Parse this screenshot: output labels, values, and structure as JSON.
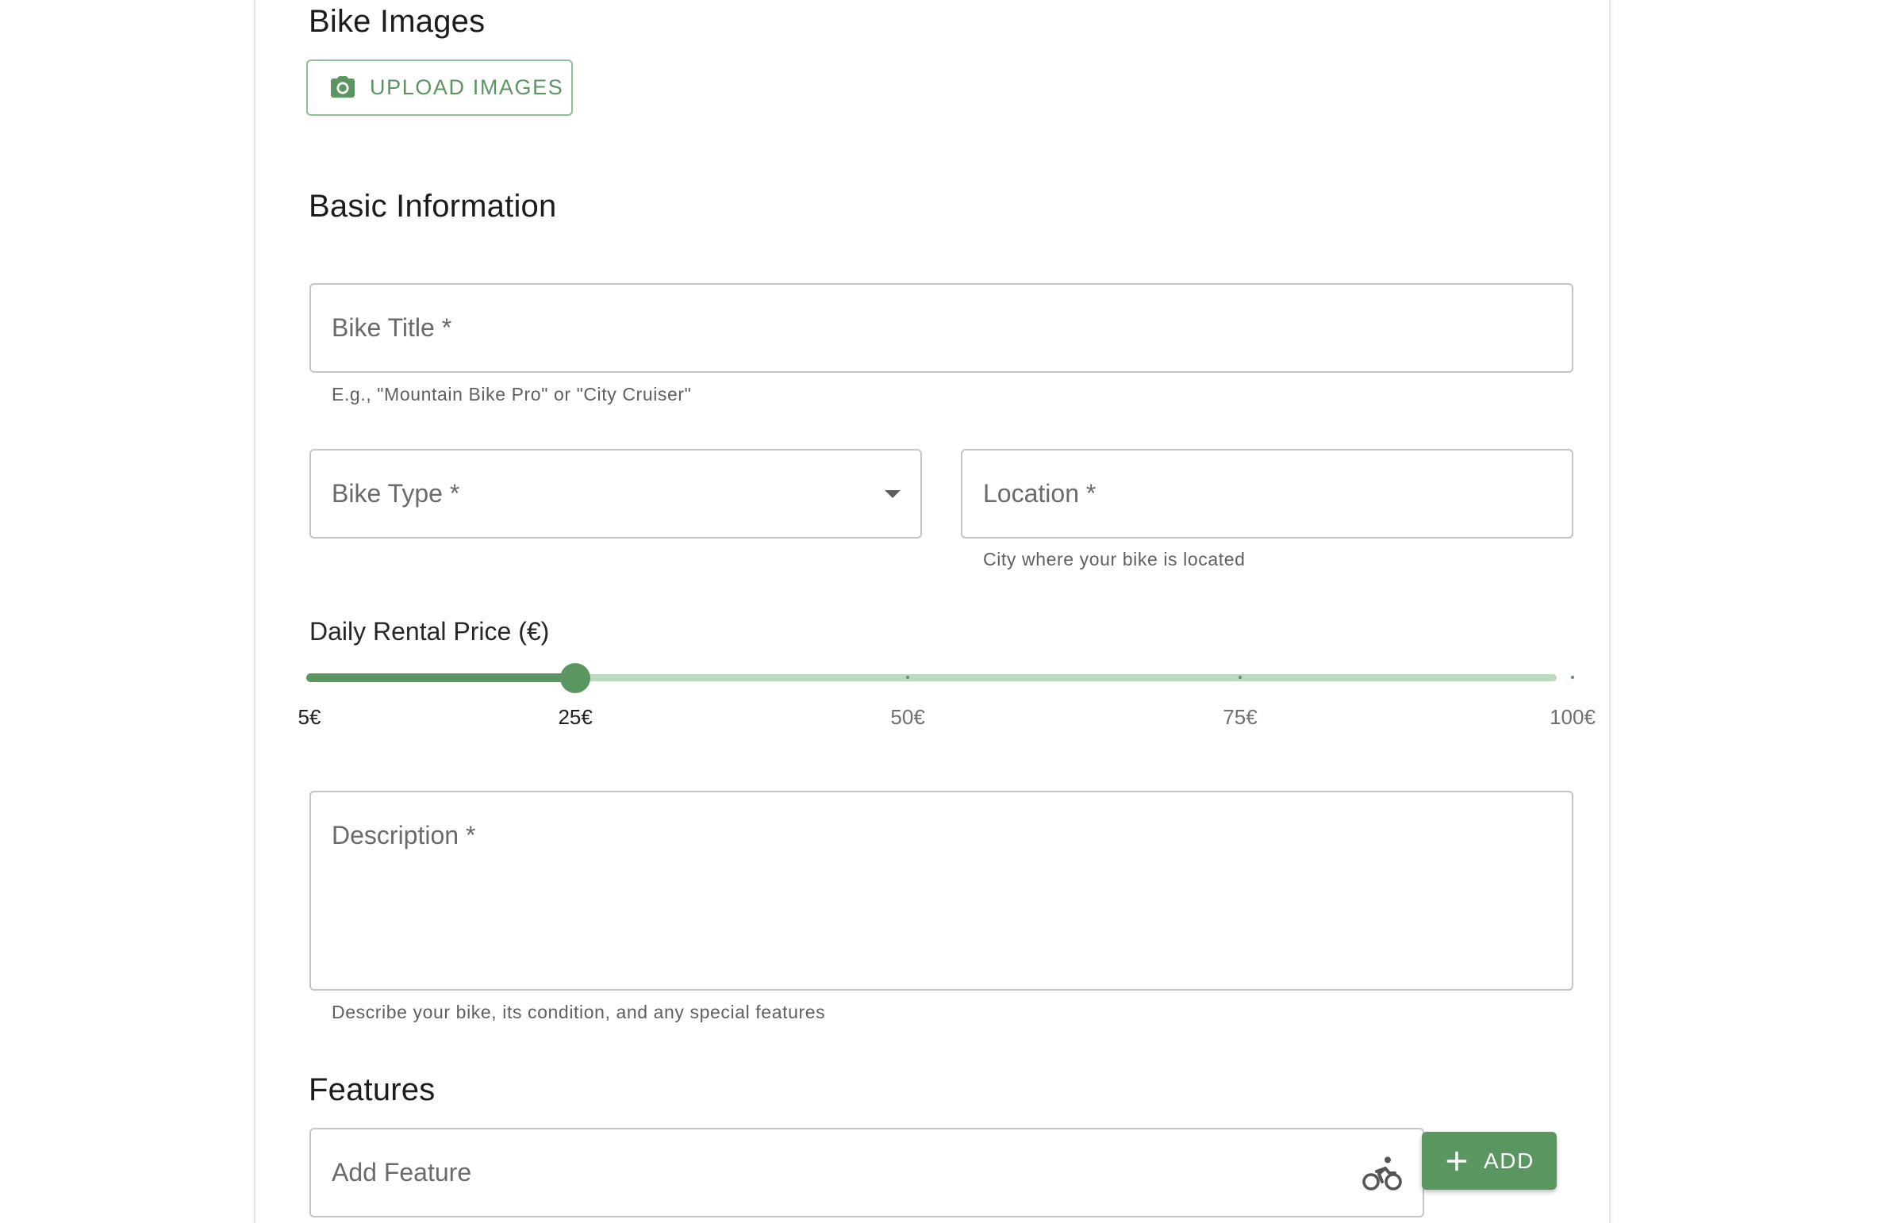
{
  "sections": {
    "bike_images": "Bike Images",
    "basic_information": "Basic Information",
    "features": "Features"
  },
  "upload": {
    "label": "UPLOAD IMAGES",
    "icon": "camera-icon"
  },
  "fields": {
    "bike_title": {
      "label": "Bike Title *",
      "helper": "E.g., \"Mountain Bike Pro\" or \"City Cruiser\""
    },
    "bike_type": {
      "label": "Bike Type *",
      "icon": "chevron-down-icon"
    },
    "location": {
      "label": "Location *",
      "helper": "City where your bike is located"
    },
    "description": {
      "label": "Description *",
      "helper": "Describe your bike, its condition, and any special features"
    },
    "add_feature": {
      "label": "Add Feature",
      "icon": "bicycle-icon"
    }
  },
  "price_slider": {
    "label": "Daily Rental Price (€)",
    "min": 5,
    "max": 100,
    "value": 25,
    "marks": [
      {
        "value": 5,
        "label": "5€"
      },
      {
        "value": 25,
        "label": "25€"
      },
      {
        "value": 50,
        "label": "50€"
      },
      {
        "value": 75,
        "label": "75€"
      },
      {
        "value": 100,
        "label": "100€"
      }
    ]
  },
  "add_button": {
    "label": "ADD",
    "icon": "plus-icon"
  },
  "colors": {
    "primary": "#5a9660",
    "primary_light": "#bcd9bf",
    "outline": "#8fbf92"
  }
}
